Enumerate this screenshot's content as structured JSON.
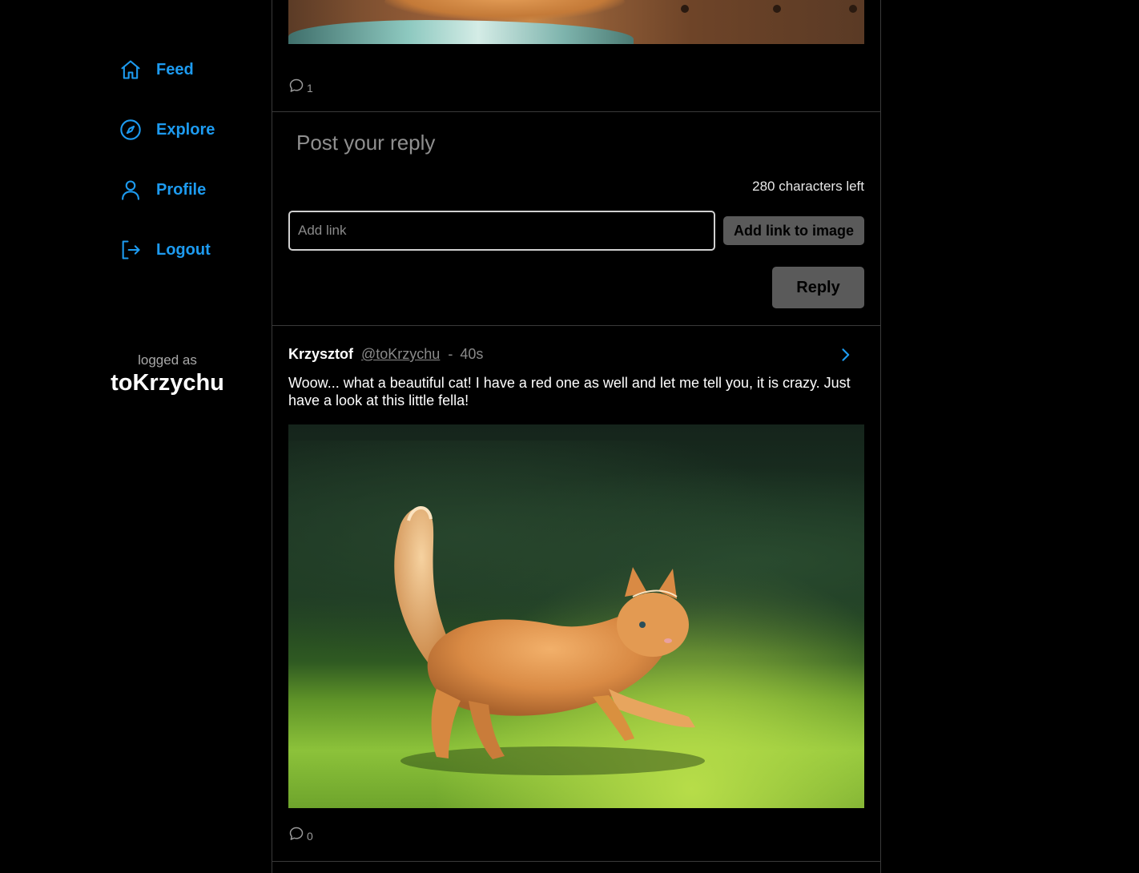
{
  "sidebar": {
    "nav": [
      {
        "label": "Feed",
        "icon": "home-icon"
      },
      {
        "label": "Explore",
        "icon": "compass-icon"
      },
      {
        "label": "Profile",
        "icon": "user-icon"
      },
      {
        "label": "Logout",
        "icon": "logout-icon"
      }
    ],
    "logged_as_label": "logged as",
    "username": "toKrzychu"
  },
  "top_post": {
    "comment_count": "1"
  },
  "reply_box": {
    "placeholder": "Post your reply",
    "chars_left": "280 characters left",
    "link_placeholder": "Add link",
    "add_link_button": "Add link to image",
    "reply_button": "Reply"
  },
  "post": {
    "author_name": "Krzysztof",
    "author_handle": "@toKrzychu",
    "separator": "-",
    "time": "40s",
    "text": "Woow... what a beautiful cat! I have a red one as well and let me tell you, it is crazy. Just have a look at this little fella!",
    "comment_count": "0"
  },
  "colors": {
    "accent": "#1d9bf0",
    "background": "#000000",
    "border": "#3a3a3a",
    "button": "#5a5a5a"
  }
}
